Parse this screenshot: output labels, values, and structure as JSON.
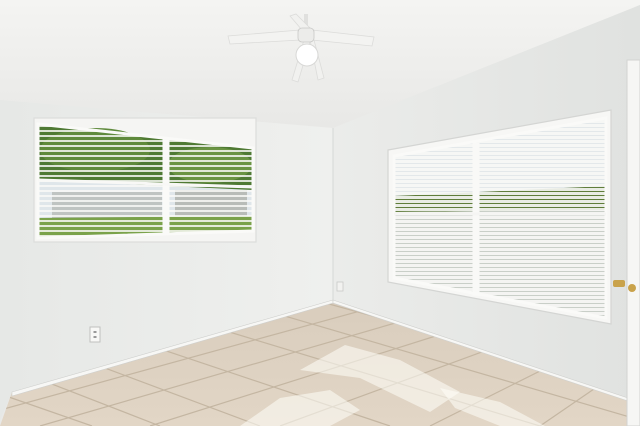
{
  "scene": {
    "kind": "photo",
    "objects": [
      "ceiling-fan",
      "window-left",
      "window-right",
      "tile-floor",
      "baseboard",
      "electrical-outlet",
      "door-edge"
    ],
    "colors": {
      "ceiling": "#f1f1ef",
      "left_wall": "#eceeec",
      "right_wall": "#e4e6e4",
      "floor_tile": "#dcd0bf",
      "grout": "#c6b8a4",
      "blinds": "#f7f7f5",
      "foliage": "#5f8a3c",
      "sky": "#dfe6ea"
    }
  }
}
